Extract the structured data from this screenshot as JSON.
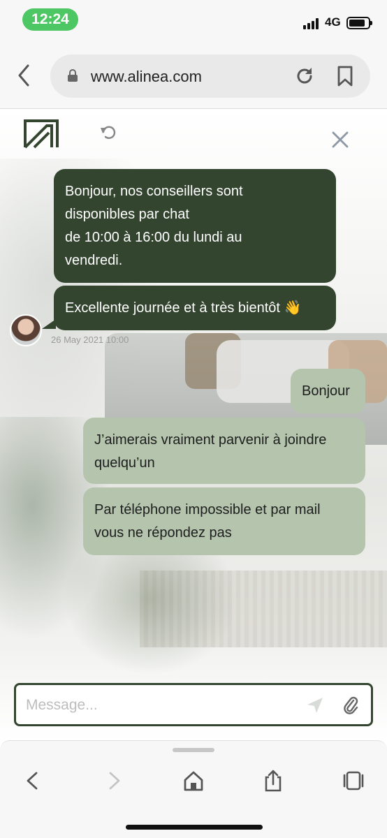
{
  "status_bar": {
    "time": "12:24",
    "network": "4G"
  },
  "browser": {
    "url": "www.alinea.com"
  },
  "chat": {
    "messages": [
      {
        "from": "agent",
        "lines": [
          "Bonjour,  nos conseillers sont",
          "disponibles par chat",
          "de 10:00  à 16:00 du lundi au",
          "vendredi."
        ]
      },
      {
        "from": "agent",
        "lines": [
          "Excellente journée et à très bientôt 👋"
        ]
      },
      {
        "from": "user",
        "lines": [
          "Bonjour"
        ]
      },
      {
        "from": "user",
        "lines": [
          "J’aimerais vraiment parvenir à joindre",
          "quelqu’un"
        ]
      },
      {
        "from": "user",
        "lines": [
          "Par téléphone impossible et par mail",
          "vous ne répondez pas"
        ]
      }
    ],
    "timestamp": "26 May 2021 10:00"
  },
  "composer": {
    "placeholder": "Message..."
  },
  "colors": {
    "agent_bubble": "#33452f",
    "user_bubble": "#b4c4ad",
    "time_pill": "#4cc764"
  },
  "icons": [
    "back-icon",
    "lock-icon",
    "reload-icon",
    "bookmark-icon",
    "logo-icon",
    "undo-icon",
    "close-icon",
    "send-icon",
    "paperclip-icon",
    "forward-icon",
    "home-icon",
    "share-icon",
    "tabs-icon"
  ]
}
